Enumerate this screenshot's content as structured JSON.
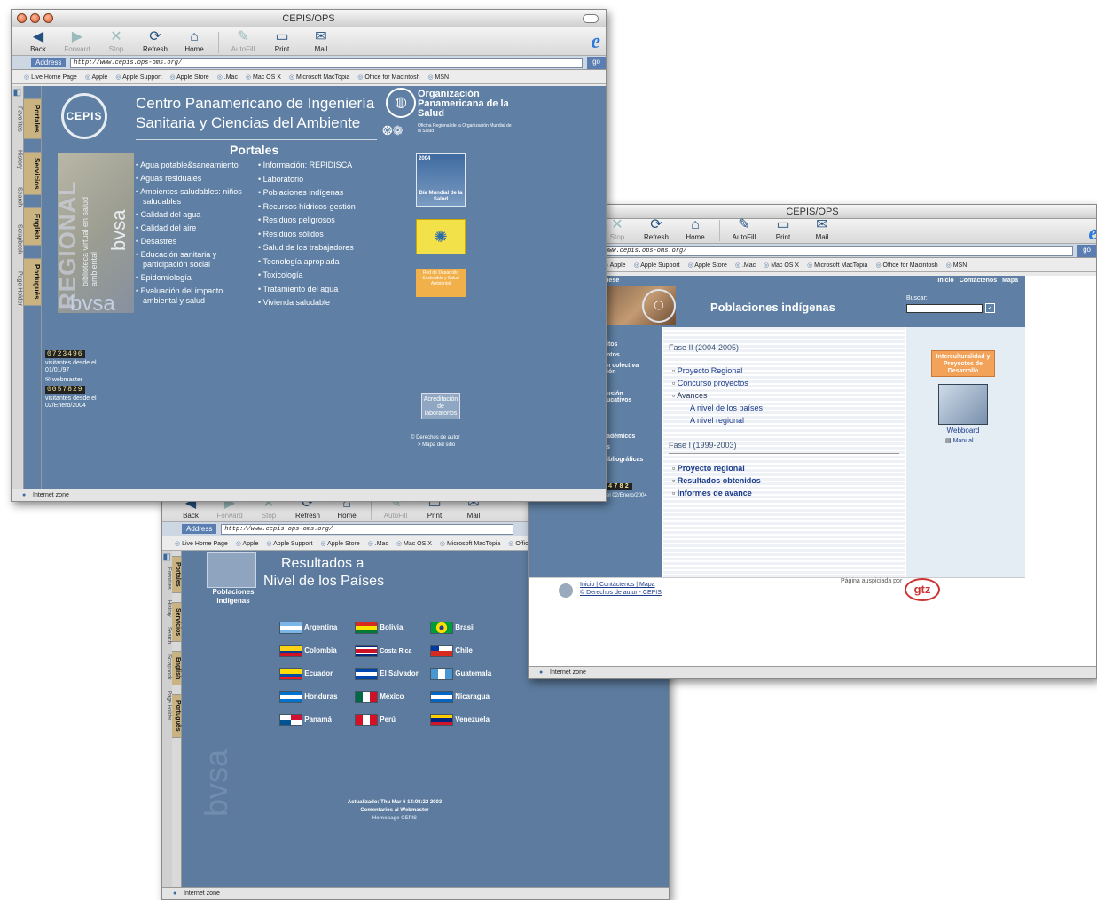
{
  "browser": {
    "back": "Back",
    "forward": "Forward",
    "stop": "Stop",
    "refresh": "Refresh",
    "home": "Home",
    "autofill": "AutoFill",
    "print": "Print",
    "mail": "Mail",
    "address_label": "Address",
    "go": "go",
    "status": "Internet zone"
  },
  "favorites": [
    "Live Home Page",
    "Apple",
    "Apple Support",
    "Apple Store",
    ".Mac",
    "Mac OS X",
    "Microsoft MacTopia",
    "Office for Macintosh",
    "MSN"
  ],
  "explorer_tabs": [
    "Favorites",
    "History",
    "Search",
    "Scrapbook",
    "Page Holder"
  ],
  "cepis_tabs": [
    "Portales",
    "Servicios",
    "English",
    "Português"
  ],
  "win1": {
    "title": "CEPIS/OPS",
    "url": "http://www.cepis.ops-oms.org/",
    "title1": "Centro Panamericano de Ingeniería",
    "title2": "Sanitaria y Ciencias del Ambiente",
    "org": "Organización Panamericana de la Salud",
    "org_sub": "Oficina Regional de la Organización Mundial de la Salud",
    "portales": "Portales",
    "col1": [
      "Agua potable&saneamiento",
      "Aguas residuales",
      "Ambientes saludables: niños saludables",
      "Calidad del agua",
      "Calidad del aire",
      "Desastres",
      "Educación sanitaria y participación social",
      "Epidemiología",
      "Evaluación del impacto ambiental y salud"
    ],
    "col2": [
      "Información: REPIDISCA",
      "Laboratorio",
      "Poblaciones indígenas",
      "Recursos hídricos-gestión",
      "Residuos peligrosos",
      "Residuos sólidos",
      "Salud de los trabajadores",
      "Tecnología apropiada",
      "Toxicología",
      "Tratamiento del agua",
      "Vivienda saludable"
    ],
    "bvsa_text": "biblioteca virtual en salud ambiental",
    "regional": "REGIONAL",
    "bvsa": "bvsa",
    "counter1": "0723496",
    "since1": "visitantes desde el 01/01/97",
    "webmaster": "webmaster",
    "counter2": "0057829",
    "since2": "visitantes desde el 02/Enero/2004",
    "ad_year": "2004",
    "ad_dia": "Día Mundial de la Salud",
    "ad_red": "Red de Desarrollo Sostenible y Salud Ambiental",
    "acred": "Acreditación de laboratorios",
    "derechos": "© Derechos de autor",
    "mapa": "> Mapa del sitio",
    "cepis_logo": "CEPIS"
  },
  "win2": {
    "title": "CEPIS/OPS",
    "url": "www.cepis.ops-oms.org/",
    "nav_left": "guese",
    "top_links": [
      "Inicio",
      "Contáctenos",
      "Mapa"
    ],
    "buscar": "Buscar:",
    "heading": "Poblaciones indígenas",
    "side_items": [
      "itos",
      "ntos",
      "n colectiva ión",
      "usión ucativos",
      "adémicos",
      "s",
      "ibliográficas"
    ],
    "counter": "4782",
    "since": "el 02/Enero/2004",
    "fase2": "Fase II (2004-2005)",
    "fase2_items": [
      "Proyecto Regional",
      "Concurso proyectos",
      "Avances"
    ],
    "avances": [
      "A nivel de los países",
      "A nivel regional"
    ],
    "fase1": "Fase I (1999-2003)",
    "fase1_items": [
      "Proyecto regional",
      "Resultados obtenidos",
      "Informes de avance"
    ],
    "intercul": "Interculturalidad y Proyectos de Desarrollo",
    "webboard": "Webboard",
    "manual": "Manual",
    "footer_links": "Inicio | Contáctenos | Mapa",
    "footer_copy": "© Derechos de autor - CEPIS",
    "auspiciada": "Página auspiciada por",
    "gtz": "gtz"
  },
  "win3": {
    "url": "http://www.cepis.ops-oms.org/",
    "pob": "Poblaciones indígenas",
    "title1": "Resultados a",
    "title2": "Nivel de los Países",
    "countries": [
      "Argentina",
      "Bolivia",
      "Brasil",
      "Colombia",
      "Costa Rica",
      "Chile",
      "Ecuador",
      "El Salvador",
      "Guatemala",
      "Honduras",
      "México",
      "Nicaragua",
      "Panamá",
      "Perú",
      "Venezuela"
    ],
    "actualizado": "Actualizado: Thu Mar 6 14:08:22 2003",
    "comentarios": "Comentarios al Webmaster",
    "homepage": "Homepage CEPIS",
    "bvsa": "bvsa"
  }
}
